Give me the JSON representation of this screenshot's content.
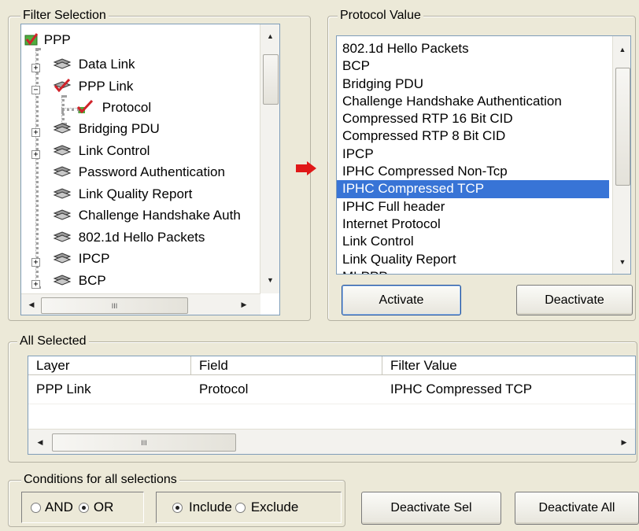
{
  "filter_selection": {
    "label": "Filter Selection",
    "tree": [
      {
        "label": "PPP"
      },
      {
        "label": "Data Link"
      },
      {
        "label": "PPP Link"
      },
      {
        "label": "Protocol"
      },
      {
        "label": "Bridging PDU"
      },
      {
        "label": "Link Control"
      },
      {
        "label": "Password Authentication"
      },
      {
        "label": "Link Quality Report"
      },
      {
        "label": "Challenge Handshake Auth"
      },
      {
        "label": "802.1d Hello Packets"
      },
      {
        "label": "IPCP"
      },
      {
        "label": "BCP"
      }
    ],
    "hscroll_grip": "III"
  },
  "protocol_value": {
    "label": "Protocol Value",
    "items": [
      "802.1d Hello Packets",
      "BCP",
      "Bridging PDU",
      "Challenge Handshake Authentication",
      "Compressed RTP 16 Bit CID",
      "Compressed RTP 8 Bit CID",
      "IPCP",
      "IPHC Compressed Non-Tcp",
      "IPHC Compressed TCP",
      "IPHC Full header",
      "Internet Protocol",
      "Link Control",
      "Link Quality Report",
      "MLPPP"
    ],
    "selected": "IPHC Compressed TCP",
    "activate": "Activate",
    "deactivate": "Deactivate"
  },
  "all_selected": {
    "label": "All Selected",
    "columns": [
      "Layer",
      "Field",
      "Filter Value"
    ],
    "rows": [
      [
        "PPP Link",
        "Protocol",
        "IPHC Compressed TCP"
      ]
    ],
    "hscroll_grip": "III"
  },
  "conditions": {
    "label": "Conditions for all selections",
    "and": "AND",
    "or": "OR",
    "include": "Include",
    "exclude": "Exclude",
    "logic_selected": "OR",
    "mode_selected": "Include"
  },
  "buttons": {
    "deactivate_sel": "Deactivate Sel",
    "deactivate_all": "Deactivate All"
  },
  "colors": {
    "selection": "#3874d6",
    "window_bg": "#ece9d8",
    "arrow": "#e01818"
  }
}
